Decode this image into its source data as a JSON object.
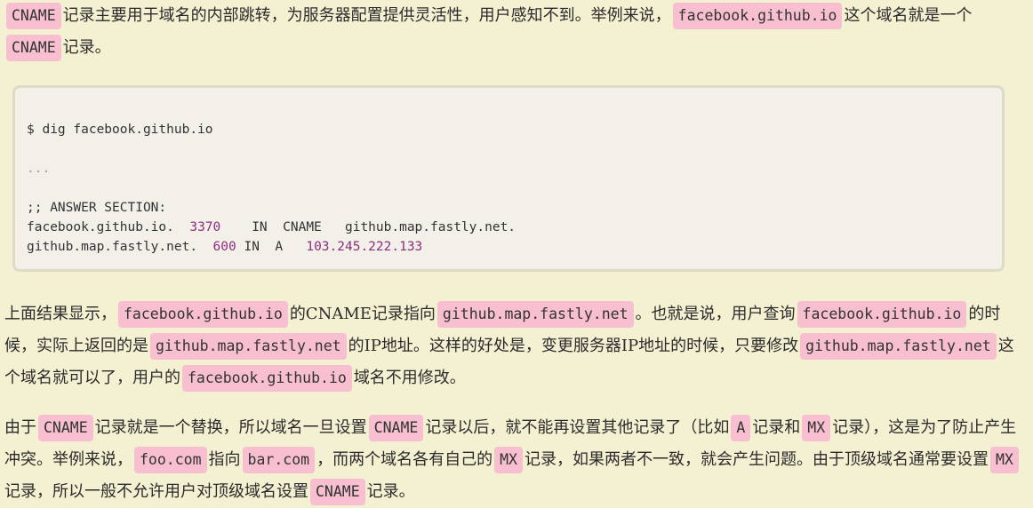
{
  "p1": {
    "t1": "CNAME",
    "t2": "记录主要用于域名的内部跳转，为服务器配置提供灵活性，用户感知不到。举例来说，",
    "t3": "facebook.github.io",
    "t4": "这个域名就是一个",
    "t5": "CNAME",
    "t6": "记录。"
  },
  "code": {
    "cmd": "$ dig facebook.github.io",
    "ellipsis": "...",
    "section": ";; ANSWER SECTION:",
    "row1": {
      "name": "facebook.github.io.",
      "ttl": "3370",
      "class": "IN",
      "type": "CNAME",
      "value": "github.map.fastly.net."
    },
    "row2": {
      "name": "github.map.fastly.net.",
      "ttl": "600",
      "class": "IN",
      "type": "A",
      "value": "103.245.222.133"
    }
  },
  "p2": {
    "t1": "上面结果显示，",
    "t2": "facebook.github.io",
    "t3": "的CNAME记录指向",
    "t4": "github.map.fastly.net",
    "t5": "。也就是说，用户查询",
    "t6": "facebook.github.io",
    "t7": "的时候，实际上返回的是",
    "t8": "github.map.fastly.net",
    "t9": "的IP地址。这样的好处是，变更服务器IP地址的时候，只要修改",
    "t10": "github.map.fastly.net",
    "t11": "这个域名就可以了，用户的",
    "t12": "facebook.github.io",
    "t13": "域名不用修改。"
  },
  "p3": {
    "t1": "由于",
    "t2": "CNAME",
    "t3": "记录就是一个替换，所以域名一旦设置",
    "t4": "CNAME",
    "t5": "记录以后，就不能再设置其他记录了（比如",
    "t6": "A",
    "t7": "记录和",
    "t8": "MX",
    "t9": "记录），这是为了防止产生冲突。举例来说，",
    "t10": "foo.com",
    "t11": "指向",
    "t12": "bar.com",
    "t13": "，而两个域名各有自己的",
    "t14": "MX",
    "t15": "记录，如果两者不一致，就会产生问题。由于顶级域名通常要设置",
    "t16": "MX",
    "t17": "记录，所以一般不允许用户对顶级域名设置",
    "t18": "CNAME",
    "t19": "记录。"
  }
}
